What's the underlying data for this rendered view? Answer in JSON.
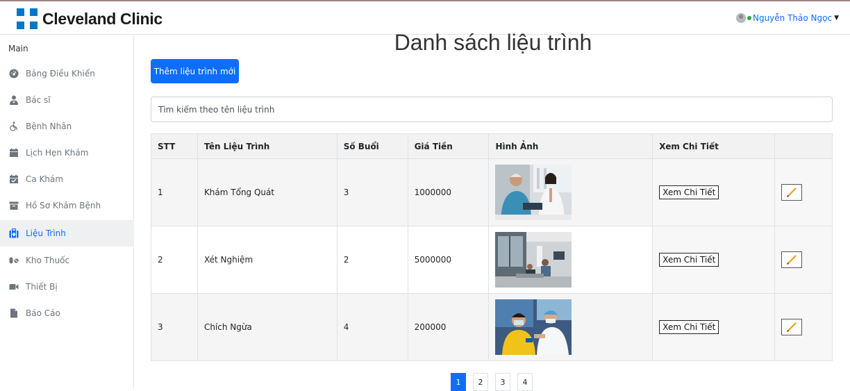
{
  "header": {
    "brand": "Cleveland Clinic",
    "user_name": "Nguyễn Thảo Ngọc",
    "logo_color": "#0077c8"
  },
  "sidebar": {
    "heading": "Main",
    "items": [
      {
        "label": "Bảng Điều Khiển",
        "icon": "dashboard-icon",
        "active": false
      },
      {
        "label": "Bác sĩ",
        "icon": "doctor-icon",
        "active": false
      },
      {
        "label": "Bệnh Nhân",
        "icon": "wheelchair-icon",
        "active": false
      },
      {
        "label": "Lịch Hẹn Khám",
        "icon": "calendar-icon",
        "active": false
      },
      {
        "label": "Ca Khám",
        "icon": "calendar-check-icon",
        "active": false
      },
      {
        "label": "Hồ Sơ Khám Bệnh",
        "icon": "archive-icon",
        "active": false
      },
      {
        "label": "Liệu Trình",
        "icon": "first-aid-kit-icon",
        "active": true
      },
      {
        "label": "Kho Thuốc",
        "icon": "pills-icon",
        "active": false
      },
      {
        "label": "Thiết Bị",
        "icon": "video-camera-icon",
        "active": false
      },
      {
        "label": "Báo Cáo",
        "icon": "file-icon",
        "active": false
      }
    ]
  },
  "main": {
    "title": "Danh sách liệu trình",
    "add_button": "Thêm liệu trình mới",
    "search_placeholder": "Tìm kiếm theo tên liệu trình",
    "accent_color": "#0d6efd"
  },
  "table": {
    "columns": [
      "STT",
      "Tên Liệu Trình",
      "Số Buổi",
      "Giá Tiền",
      "Hình Ảnh",
      "Xem Chi Tiết",
      ""
    ],
    "detail_label": "Xem Chi Tiết",
    "rows": [
      {
        "stt": "1",
        "name": "Khám Tổng Quát",
        "sessions": "3",
        "price": "1000000",
        "image": "doctor-checkup-photo"
      },
      {
        "stt": "2",
        "name": "Xét Nghiệm",
        "sessions": "2",
        "price": "5000000",
        "image": "lab-room-photo"
      },
      {
        "stt": "3",
        "name": "Chích Ngừa",
        "sessions": "4",
        "price": "200000",
        "image": "child-vaccination-photo"
      }
    ]
  },
  "pagination": {
    "pages": [
      "1",
      "2",
      "3",
      "4"
    ],
    "current": "1"
  }
}
